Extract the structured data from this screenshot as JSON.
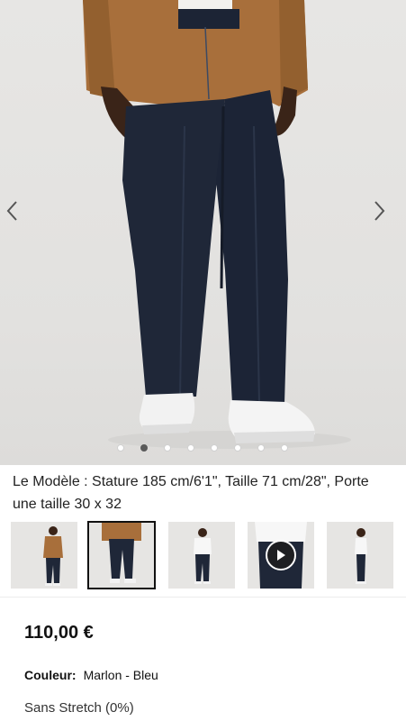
{
  "product": {
    "model_caption": "Le Modèle : Stature 185 cm/6'1\", Taille 71 cm/28\", Porte une taille 30 x 32",
    "price": "110,00 €",
    "color_label": "Couleur:",
    "color_value": "Marlon - Bleu",
    "stretch": "Sans Stretch (0%)"
  },
  "carousel": {
    "slide_count": 8,
    "active_slide": 1,
    "prev_icon": "chevron-left-icon",
    "next_icon": "chevron-right-icon"
  },
  "thumbnails": [
    {
      "name": "thumb-front-full",
      "active": false
    },
    {
      "name": "thumb-front-closeup",
      "active": true
    },
    {
      "name": "thumb-white-shirt-front",
      "active": false
    },
    {
      "name": "thumb-back-video",
      "active": false,
      "icon": "play-icon"
    },
    {
      "name": "thumb-side",
      "active": false
    }
  ],
  "colors": {
    "denim": "#1f2738",
    "jacket": "#a8703d",
    "sneaker": "#f3f3f3",
    "background": "#e4e3e1"
  }
}
